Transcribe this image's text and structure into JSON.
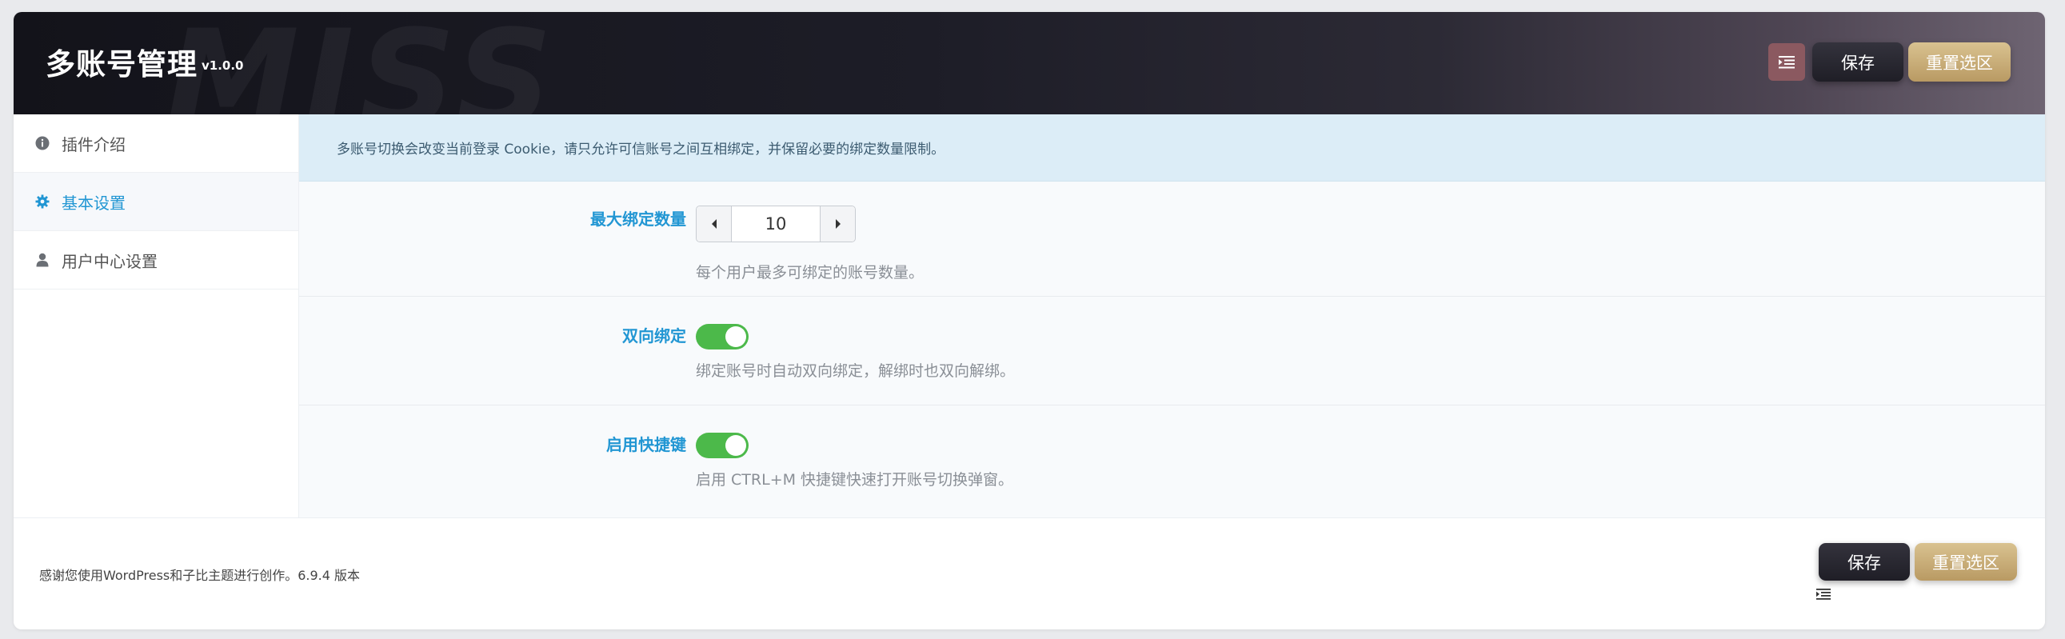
{
  "header": {
    "watermark": "MISS",
    "title": "多账号管理",
    "version": "v1.0.0",
    "save_label": "保存",
    "reset_label": "重置选区"
  },
  "sidebar": {
    "items": [
      {
        "label": "插件介绍",
        "icon": "info-icon",
        "active": false
      },
      {
        "label": "基本设置",
        "icon": "gear-icon",
        "active": true
      },
      {
        "label": "用户中心设置",
        "icon": "user-icon",
        "active": false
      }
    ]
  },
  "main": {
    "notice": "多账号切换会改变当前登录 Cookie，请只允许可信账号之间互相绑定，并保留必要的绑定数量限制。",
    "settings": {
      "max_bind": {
        "label": "最大绑定数量",
        "value": "10",
        "desc": "每个用户最多可绑定的账号数量。"
      },
      "two_way": {
        "label": "双向绑定",
        "enabled": true,
        "desc": "绑定账号时自动双向绑定，解绑时也双向解绑。"
      },
      "shortcut": {
        "label": "启用快捷键",
        "enabled": true,
        "desc": "启用 CTRL+M 快捷键快速打开账号切换弹窗。"
      }
    }
  },
  "footer": {
    "text": "感谢您使用WordPress和子比主题进行创作。6.9.4 版本",
    "save_label": "保存",
    "reset_label": "重置选区"
  },
  "colors": {
    "accent": "#2196d3",
    "toggle_on": "#4cb94a",
    "reset_gold": "#c9ad78",
    "save_dark": "#2a2932"
  }
}
